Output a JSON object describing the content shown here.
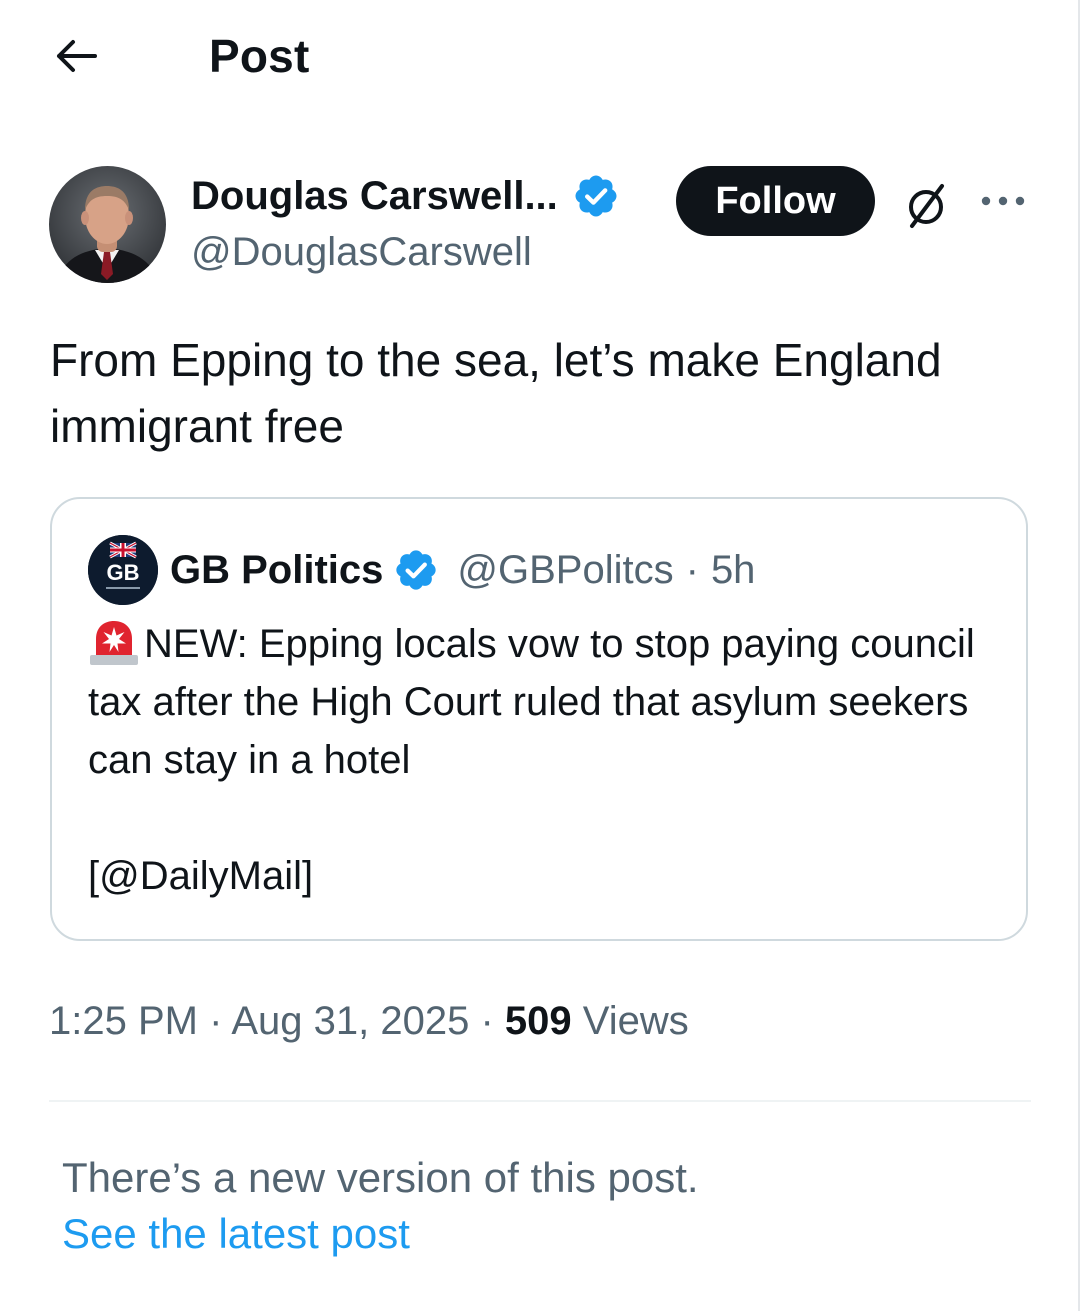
{
  "header": {
    "title": "Post",
    "back_icon": "arrow-left-icon"
  },
  "author": {
    "name": "Douglas Carswell...",
    "handle": "@DouglasCarswell",
    "verified": true,
    "verified_color": "#1d9bf0"
  },
  "actions": {
    "follow_label": "Follow",
    "grok_icon": "slashed-circle-icon",
    "more_icon": "more-horizontal-icon"
  },
  "post": {
    "text": "From Epping to the sea, let’s make England immigrant free"
  },
  "quote": {
    "avatar_text": "GB",
    "name": "GB Politics",
    "verified": true,
    "handle": "@GBPolitcs",
    "separator": "·",
    "time": "5h",
    "body_icon": "police-siren-icon",
    "body": "NEW: Epping locals vow to stop paying council tax after the High Court ruled that asylum seekers can stay in a hotel",
    "source": "[@DailyMail]"
  },
  "meta": {
    "time": "1:25 PM",
    "sep1": "·",
    "date": "Aug 31, 2025",
    "sep2": "·",
    "views_count": "509",
    "views_label": "Views"
  },
  "notice": {
    "text": "There’s a new version of this post.",
    "link": "See the latest post"
  },
  "colors": {
    "accent": "#1d9bf0",
    "text_primary": "#0f1419",
    "text_secondary": "#536471",
    "border": "#cfd9de"
  }
}
